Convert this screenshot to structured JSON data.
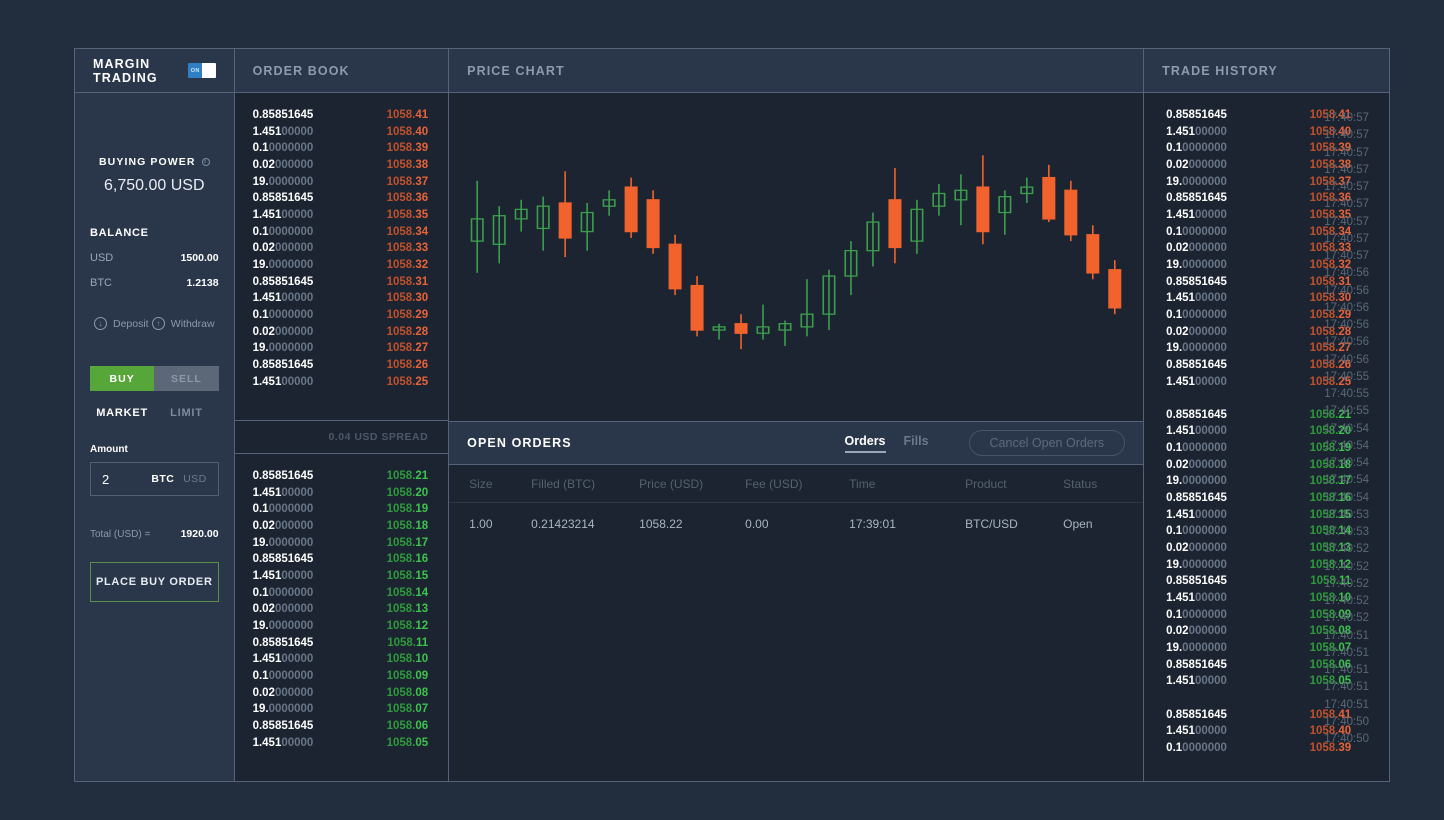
{
  "margin_panel": {
    "title": "MARGIN TRADING",
    "toggle": {
      "state_label": "ON",
      "on": true
    },
    "buying_power_label": "BUYING POWER",
    "buying_power_value": "6,750.00 USD",
    "balance_label": "BALANCE",
    "balances": [
      {
        "currency": "USD",
        "amount": "1500.00"
      },
      {
        "currency": "BTC",
        "amount": "1.2138"
      }
    ],
    "deposit_label": "Deposit",
    "withdraw_label": "Withdraw",
    "side_buy": "BUY",
    "side_sell": "SELL",
    "type_market": "MARKET",
    "type_limit": "LIMIT",
    "amount_label": "Amount",
    "amount_value": "2",
    "amount_unit_active": "BTC",
    "amount_unit_idle": "USD",
    "total_label": "Total",
    "total_currency": "(USD) =",
    "total_value": "1920.00",
    "place_order_label": "PLACE BUY ORDER"
  },
  "order_book": {
    "title": "ORDER BOOK",
    "spread_label": "0.04 USD SPREAD",
    "asks": [
      {
        "size_main": "0.85851645",
        "size_dim": "",
        "price_main": "1058.",
        "price_dec": "41"
      },
      {
        "size_main": "1.451",
        "size_dim": "00000",
        "price_main": "1058.",
        "price_dec": "40"
      },
      {
        "size_main": "0.1",
        "size_dim": "0000000",
        "price_main": "1058.",
        "price_dec": "39"
      },
      {
        "size_main": "0.02",
        "size_dim": "000000",
        "price_main": "1058.",
        "price_dec": "38"
      },
      {
        "size_main": "19.",
        "size_dim": "0000000",
        "price_main": "1058.",
        "price_dec": "37"
      },
      {
        "size_main": "0.85851645",
        "size_dim": "",
        "price_main": "1058.",
        "price_dec": "36"
      },
      {
        "size_main": "1.451",
        "size_dim": "00000",
        "price_main": "1058.",
        "price_dec": "35"
      },
      {
        "size_main": "0.1",
        "size_dim": "0000000",
        "price_main": "1058.",
        "price_dec": "34"
      },
      {
        "size_main": "0.02",
        "size_dim": "000000",
        "price_main": "1058.",
        "price_dec": "33"
      },
      {
        "size_main": "19.",
        "size_dim": "0000000",
        "price_main": "1058.",
        "price_dec": "32"
      },
      {
        "size_main": "0.85851645",
        "size_dim": "",
        "price_main": "1058.",
        "price_dec": "31"
      },
      {
        "size_main": "1.451",
        "size_dim": "00000",
        "price_main": "1058.",
        "price_dec": "30"
      },
      {
        "size_main": "0.1",
        "size_dim": "0000000",
        "price_main": "1058.",
        "price_dec": "29"
      },
      {
        "size_main": "0.02",
        "size_dim": "000000",
        "price_main": "1058.",
        "price_dec": "28"
      },
      {
        "size_main": "19.",
        "size_dim": "0000000",
        "price_main": "1058.",
        "price_dec": "27"
      },
      {
        "size_main": "0.85851645",
        "size_dim": "",
        "price_main": "1058.",
        "price_dec": "26"
      },
      {
        "size_main": "1.451",
        "size_dim": "00000",
        "price_main": "1058.",
        "price_dec": "25"
      }
    ],
    "bids": [
      {
        "size_main": "0.85851645",
        "size_dim": "",
        "price_main": "1058.",
        "price_dec": "21"
      },
      {
        "size_main": "1.451",
        "size_dim": "00000",
        "price_main": "1058.",
        "price_dec": "20"
      },
      {
        "size_main": "0.1",
        "size_dim": "0000000",
        "price_main": "1058.",
        "price_dec": "19"
      },
      {
        "size_main": "0.02",
        "size_dim": "000000",
        "price_main": "1058.",
        "price_dec": "18"
      },
      {
        "size_main": "19.",
        "size_dim": "0000000",
        "price_main": "1058.",
        "price_dec": "17"
      },
      {
        "size_main": "0.85851645",
        "size_dim": "",
        "price_main": "1058.",
        "price_dec": "16"
      },
      {
        "size_main": "1.451",
        "size_dim": "00000",
        "price_main": "1058.",
        "price_dec": "15"
      },
      {
        "size_main": "0.1",
        "size_dim": "0000000",
        "price_main": "1058.",
        "price_dec": "14"
      },
      {
        "size_main": "0.02",
        "size_dim": "000000",
        "price_main": "1058.",
        "price_dec": "13"
      },
      {
        "size_main": "19.",
        "size_dim": "0000000",
        "price_main": "1058.",
        "price_dec": "12"
      },
      {
        "size_main": "0.85851645",
        "size_dim": "",
        "price_main": "1058.",
        "price_dec": "11"
      },
      {
        "size_main": "1.451",
        "size_dim": "00000",
        "price_main": "1058.",
        "price_dec": "10"
      },
      {
        "size_main": "0.1",
        "size_dim": "0000000",
        "price_main": "1058.",
        "price_dec": "09"
      },
      {
        "size_main": "0.02",
        "size_dim": "000000",
        "price_main": "1058.",
        "price_dec": "08"
      },
      {
        "size_main": "19.",
        "size_dim": "0000000",
        "price_main": "1058.",
        "price_dec": "07"
      },
      {
        "size_main": "0.85851645",
        "size_dim": "",
        "price_main": "1058.",
        "price_dec": "06"
      },
      {
        "size_main": "1.451",
        "size_dim": "00000",
        "price_main": "1058.",
        "price_dec": "05"
      }
    ]
  },
  "price_chart": {
    "title": "PRICE CHART"
  },
  "open_orders": {
    "title": "OPEN ORDERS",
    "tab_orders": "Orders",
    "tab_fills": "Fills",
    "cancel_label": "Cancel Open Orders",
    "columns": [
      "Size",
      "Filled (BTC)",
      "Price (USD)",
      "Fee (USD)",
      "Time",
      "Product",
      "Status"
    ],
    "rows": [
      {
        "size": "1.00",
        "filled": "0.21423214",
        "price": "1058.22",
        "fee": "0.00",
        "time": "17:39:01",
        "product": "BTC/USD",
        "status": "Open"
      }
    ]
  },
  "trade_history": {
    "title": "TRADE HISTORY",
    "trades": [
      {
        "size_main": "0.85851645",
        "size_dim": "",
        "price_main": "1058.",
        "price_dec": "41",
        "side": "sell"
      },
      {
        "size_main": "1.451",
        "size_dim": "00000",
        "price_main": "1058.",
        "price_dec": "40",
        "side": "sell"
      },
      {
        "size_main": "0.1",
        "size_dim": "0000000",
        "price_main": "1058.",
        "price_dec": "39",
        "side": "sell"
      },
      {
        "size_main": "0.02",
        "size_dim": "000000",
        "price_main": "1058.",
        "price_dec": "38",
        "side": "sell"
      },
      {
        "size_main": "19.",
        "size_dim": "0000000",
        "price_main": "1058.",
        "price_dec": "37",
        "side": "sell"
      },
      {
        "size_main": "0.85851645",
        "size_dim": "",
        "price_main": "1058.",
        "price_dec": "36",
        "side": "sell"
      },
      {
        "size_main": "1.451",
        "size_dim": "00000",
        "price_main": "1058.",
        "price_dec": "35",
        "side": "sell"
      },
      {
        "size_main": "0.1",
        "size_dim": "0000000",
        "price_main": "1058.",
        "price_dec": "34",
        "side": "sell"
      },
      {
        "size_main": "0.02",
        "size_dim": "000000",
        "price_main": "1058.",
        "price_dec": "33",
        "side": "sell"
      },
      {
        "size_main": "19.",
        "size_dim": "0000000",
        "price_main": "1058.",
        "price_dec": "32",
        "side": "sell"
      },
      {
        "size_main": "0.85851645",
        "size_dim": "",
        "price_main": "1058.",
        "price_dec": "31",
        "side": "sell"
      },
      {
        "size_main": "1.451",
        "size_dim": "00000",
        "price_main": "1058.",
        "price_dec": "30",
        "side": "sell"
      },
      {
        "size_main": "0.1",
        "size_dim": "0000000",
        "price_main": "1058.",
        "price_dec": "29",
        "side": "sell"
      },
      {
        "size_main": "0.02",
        "size_dim": "000000",
        "price_main": "1058.",
        "price_dec": "28",
        "side": "sell"
      },
      {
        "size_main": "19.",
        "size_dim": "0000000",
        "price_main": "1058.",
        "price_dec": "27",
        "side": "sell"
      },
      {
        "size_main": "0.85851645",
        "size_dim": "",
        "price_main": "1058.",
        "price_dec": "26",
        "side": "sell"
      },
      {
        "size_main": "1.451",
        "size_dim": "00000",
        "price_main": "1058.",
        "price_dec": "25",
        "side": "sell"
      },
      {
        "size_main": "",
        "size_dim": "",
        "price_main": "",
        "price_dec": "",
        "side": "gap"
      },
      {
        "size_main": "0.85851645",
        "size_dim": "",
        "price_main": "1058.",
        "price_dec": "21",
        "side": "buy"
      },
      {
        "size_main": "1.451",
        "size_dim": "00000",
        "price_main": "1058.",
        "price_dec": "20",
        "side": "buy"
      },
      {
        "size_main": "0.1",
        "size_dim": "0000000",
        "price_main": "1058.",
        "price_dec": "19",
        "side": "buy"
      },
      {
        "size_main": "0.02",
        "size_dim": "000000",
        "price_main": "1058.",
        "price_dec": "18",
        "side": "buy"
      },
      {
        "size_main": "19.",
        "size_dim": "0000000",
        "price_main": "1058.",
        "price_dec": "17",
        "side": "buy"
      },
      {
        "size_main": "0.85851645",
        "size_dim": "",
        "price_main": "1058.",
        "price_dec": "16",
        "side": "buy"
      },
      {
        "size_main": "1.451",
        "size_dim": "00000",
        "price_main": "1058.",
        "price_dec": "15",
        "side": "buy"
      },
      {
        "size_main": "0.1",
        "size_dim": "0000000",
        "price_main": "1058.",
        "price_dec": "14",
        "side": "buy"
      },
      {
        "size_main": "0.02",
        "size_dim": "000000",
        "price_main": "1058.",
        "price_dec": "13",
        "side": "buy"
      },
      {
        "size_main": "19.",
        "size_dim": "0000000",
        "price_main": "1058.",
        "price_dec": "12",
        "side": "buy"
      },
      {
        "size_main": "0.85851645",
        "size_dim": "",
        "price_main": "1058.",
        "price_dec": "11",
        "side": "buy"
      },
      {
        "size_main": "1.451",
        "size_dim": "00000",
        "price_main": "1058.",
        "price_dec": "10",
        "side": "buy"
      },
      {
        "size_main": "0.1",
        "size_dim": "0000000",
        "price_main": "1058.",
        "price_dec": "09",
        "side": "buy"
      },
      {
        "size_main": "0.02",
        "size_dim": "000000",
        "price_main": "1058.",
        "price_dec": "08",
        "side": "buy"
      },
      {
        "size_main": "19.",
        "size_dim": "0000000",
        "price_main": "1058.",
        "price_dec": "07",
        "side": "buy"
      },
      {
        "size_main": "0.85851645",
        "size_dim": "",
        "price_main": "1058.",
        "price_dec": "06",
        "side": "buy"
      },
      {
        "size_main": "1.451",
        "size_dim": "00000",
        "price_main": "1058.",
        "price_dec": "05",
        "side": "buy"
      },
      {
        "size_main": "",
        "size_dim": "",
        "price_main": "",
        "price_dec": "",
        "side": "gap"
      },
      {
        "size_main": "0.85851645",
        "size_dim": "",
        "price_main": "1058.",
        "price_dec": "41",
        "side": "sell"
      },
      {
        "size_main": "1.451",
        "size_dim": "00000",
        "price_main": "1058.",
        "price_dec": "40",
        "side": "sell"
      },
      {
        "size_main": "0.1",
        "size_dim": "0000000",
        "price_main": "1058.",
        "price_dec": "39",
        "side": "sell"
      }
    ],
    "times": [
      "17:40:57",
      "17:40:57",
      "17:40:57",
      "17:40:57",
      "17:40:57",
      "17:40:57",
      "17:40:57",
      "17:40:57",
      "17:40:57",
      "17:40:56",
      "17:40:56",
      "17:40:56",
      "17:40:56",
      "17:40:56",
      "17:40:56",
      "17:40:55",
      "17:40:55",
      "17:40:55",
      "17:40:54",
      "17:40:54",
      "17:40:54",
      "17:40:54",
      "17:40:54",
      "17:40:53",
      "17:40:53",
      "17:40:52",
      "17:40:52",
      "17:40:52",
      "17:40:52",
      "17:40:52",
      "17:40:51",
      "17:40:51",
      "17:40:51",
      "17:40:51",
      "17:40:51",
      "17:40:50",
      "17:40:50"
    ]
  },
  "colors": {
    "page_bg": "#222d3d",
    "panel_bg": "#1b2430",
    "header_bg": "#2a3649",
    "border": "#55637a",
    "ask": "#e8633a",
    "bid": "#3fc24e",
    "buy_green": "#57a639",
    "sell_gray": "#5c6878",
    "toggle_blue": "#2f7fc4"
  },
  "chart_data": {
    "type": "candlestick",
    "title": "PRICE CHART",
    "xlabel": "",
    "ylabel": "",
    "grid": false,
    "legend": false,
    "ylim": [
      1053.4,
      1060.2
    ],
    "candles": [
      {
        "o": 1057.3,
        "h": 1059.2,
        "l": 1056.3,
        "c": 1058.0,
        "dir": "up"
      },
      {
        "o": 1057.2,
        "h": 1058.4,
        "l": 1056.6,
        "c": 1058.1,
        "dir": "up"
      },
      {
        "o": 1058.0,
        "h": 1058.6,
        "l": 1057.6,
        "c": 1058.3,
        "dir": "up"
      },
      {
        "o": 1057.7,
        "h": 1058.7,
        "l": 1057.0,
        "c": 1058.4,
        "dir": "up"
      },
      {
        "o": 1058.5,
        "h": 1059.5,
        "l": 1056.8,
        "c": 1057.4,
        "dir": "down"
      },
      {
        "o": 1057.6,
        "h": 1058.5,
        "l": 1057.0,
        "c": 1058.2,
        "dir": "up"
      },
      {
        "o": 1058.4,
        "h": 1058.9,
        "l": 1058.1,
        "c": 1058.6,
        "dir": "up"
      },
      {
        "o": 1059.0,
        "h": 1059.3,
        "l": 1057.4,
        "c": 1057.6,
        "dir": "down"
      },
      {
        "o": 1058.6,
        "h": 1058.9,
        "l": 1056.9,
        "c": 1057.1,
        "dir": "down"
      },
      {
        "o": 1057.2,
        "h": 1057.5,
        "l": 1055.6,
        "c": 1055.8,
        "dir": "down"
      },
      {
        "o": 1055.9,
        "h": 1056.2,
        "l": 1054.3,
        "c": 1054.5,
        "dir": "down"
      },
      {
        "o": 1054.5,
        "h": 1054.7,
        "l": 1054.2,
        "c": 1054.6,
        "dir": "up"
      },
      {
        "o": 1054.7,
        "h": 1055.0,
        "l": 1053.9,
        "c": 1054.4,
        "dir": "down"
      },
      {
        "o": 1054.4,
        "h": 1055.3,
        "l": 1054.2,
        "c": 1054.6,
        "dir": "up"
      },
      {
        "o": 1054.5,
        "h": 1054.8,
        "l": 1054.0,
        "c": 1054.7,
        "dir": "up"
      },
      {
        "o": 1054.6,
        "h": 1056.1,
        "l": 1054.3,
        "c": 1055.0,
        "dir": "up"
      },
      {
        "o": 1055.0,
        "h": 1056.4,
        "l": 1054.5,
        "c": 1056.2,
        "dir": "up"
      },
      {
        "o": 1056.2,
        "h": 1057.3,
        "l": 1055.6,
        "c": 1057.0,
        "dir": "up"
      },
      {
        "o": 1057.0,
        "h": 1058.2,
        "l": 1056.5,
        "c": 1057.9,
        "dir": "up"
      },
      {
        "o": 1058.6,
        "h": 1059.6,
        "l": 1056.6,
        "c": 1057.1,
        "dir": "down"
      },
      {
        "o": 1057.3,
        "h": 1058.6,
        "l": 1056.9,
        "c": 1058.3,
        "dir": "up"
      },
      {
        "o": 1058.4,
        "h": 1059.1,
        "l": 1058.1,
        "c": 1058.8,
        "dir": "up"
      },
      {
        "o": 1058.6,
        "h": 1059.4,
        "l": 1057.8,
        "c": 1058.9,
        "dir": "up"
      },
      {
        "o": 1059.0,
        "h": 1060.0,
        "l": 1057.2,
        "c": 1057.6,
        "dir": "down"
      },
      {
        "o": 1058.2,
        "h": 1058.9,
        "l": 1057.5,
        "c": 1058.7,
        "dir": "up"
      },
      {
        "o": 1058.8,
        "h": 1059.3,
        "l": 1058.5,
        "c": 1059.0,
        "dir": "up"
      },
      {
        "o": 1059.3,
        "h": 1059.7,
        "l": 1057.9,
        "c": 1058.0,
        "dir": "down"
      },
      {
        "o": 1058.9,
        "h": 1059.2,
        "l": 1057.3,
        "c": 1057.5,
        "dir": "down"
      },
      {
        "o": 1057.5,
        "h": 1057.8,
        "l": 1056.1,
        "c": 1056.3,
        "dir": "down"
      },
      {
        "o": 1056.4,
        "h": 1056.7,
        "l": 1055.0,
        "c": 1055.2,
        "dir": "down"
      }
    ]
  }
}
